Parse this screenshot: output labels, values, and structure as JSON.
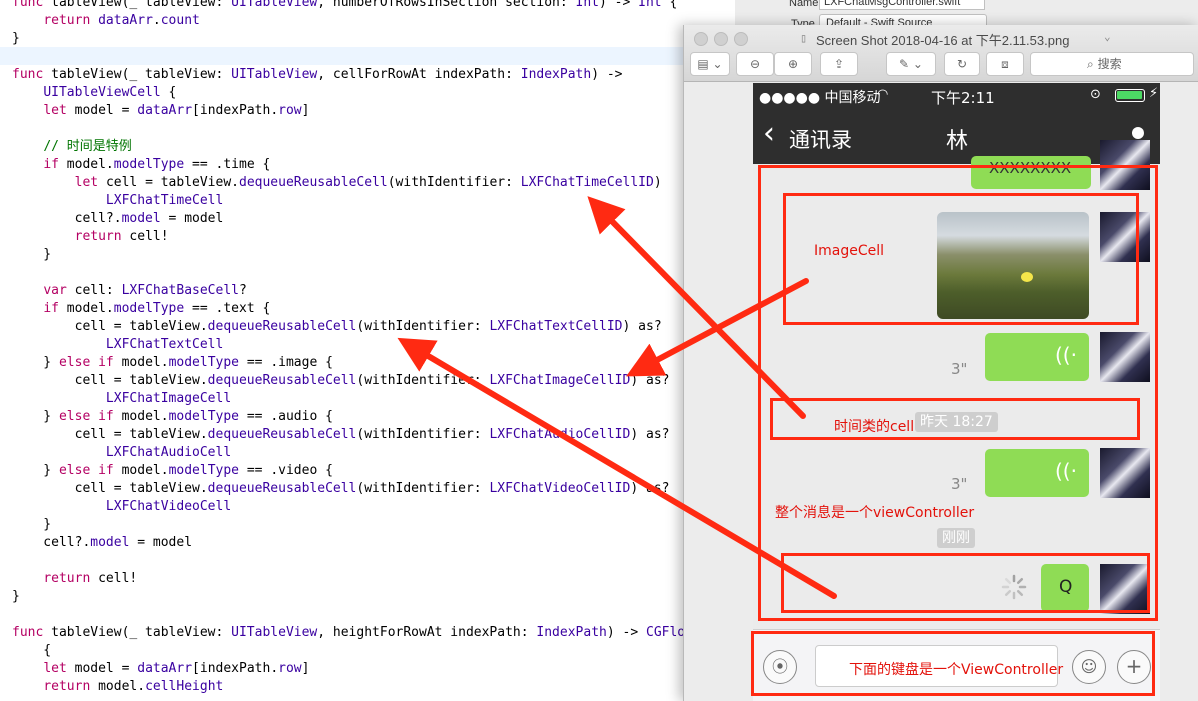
{
  "code": {
    "lines": [
      {
        "segs": [
          [
            "k",
            "func "
          ],
          [
            "",
            "tableView(_ tableView: "
          ],
          [
            "t",
            "UITableView"
          ],
          [
            "",
            ", numberOfRowsInSection section: "
          ],
          [
            "t",
            "Int"
          ],
          [
            "",
            ") -> "
          ],
          [
            "t",
            "Int"
          ],
          [
            "",
            " {"
          ]
        ]
      },
      {
        "segs": [
          [
            "",
            "    "
          ],
          [
            "k",
            "return "
          ],
          [
            "t",
            "dataArr"
          ],
          [
            "",
            "."
          ],
          [
            "t",
            "count"
          ]
        ]
      },
      {
        "segs": [
          [
            "",
            "}"
          ]
        ]
      },
      {
        "segs": [
          [
            "",
            ""
          ]
        ]
      },
      {
        "segs": [
          [
            "k",
            "func "
          ],
          [
            "",
            "tableView(_ tableView: "
          ],
          [
            "t",
            "UITableView"
          ],
          [
            "",
            ", cellForRowAt indexPath: "
          ],
          [
            "t",
            "IndexPath"
          ],
          [
            "",
            ") ->"
          ]
        ]
      },
      {
        "segs": [
          [
            "",
            "    "
          ],
          [
            "t",
            "UITableViewCell"
          ],
          [
            "",
            " {"
          ]
        ]
      },
      {
        "segs": [
          [
            "",
            "    "
          ],
          [
            "k",
            "let "
          ],
          [
            "",
            "model = "
          ],
          [
            "t",
            "dataArr"
          ],
          [
            "",
            "[indexPath."
          ],
          [
            "t",
            "row"
          ],
          [
            "",
            "]"
          ]
        ]
      },
      {
        "segs": [
          [
            "",
            ""
          ]
        ]
      },
      {
        "segs": [
          [
            "",
            "    "
          ],
          [
            "c",
            "// 时间是特例"
          ]
        ]
      },
      {
        "segs": [
          [
            "",
            "    "
          ],
          [
            "k",
            "if "
          ],
          [
            "",
            "model."
          ],
          [
            "t",
            "modelType"
          ],
          [
            "",
            " == .time {"
          ]
        ]
      },
      {
        "segs": [
          [
            "",
            "        "
          ],
          [
            "k",
            "let "
          ],
          [
            "",
            "cell = tableView."
          ],
          [
            "t",
            "dequeueReusableCell"
          ],
          [
            "",
            "(withIdentifier: "
          ],
          [
            "t",
            "LXFChatTimeCellID"
          ],
          [
            "",
            ")"
          ]
        ]
      },
      {
        "segs": [
          [
            "",
            "            "
          ],
          [
            "t",
            "LXFChatTimeCell"
          ]
        ]
      },
      {
        "segs": [
          [
            "",
            "        cell?."
          ],
          [
            "t",
            "model"
          ],
          [
            "",
            " = model"
          ]
        ]
      },
      {
        "segs": [
          [
            "",
            "        "
          ],
          [
            "k",
            "return "
          ],
          [
            "",
            "cell!"
          ]
        ]
      },
      {
        "segs": [
          [
            "",
            "    }"
          ]
        ]
      },
      {
        "segs": [
          [
            "",
            ""
          ]
        ]
      },
      {
        "segs": [
          [
            "",
            "    "
          ],
          [
            "k",
            "var "
          ],
          [
            "",
            "cell: "
          ],
          [
            "t",
            "LXFChatBaseCell"
          ],
          [
            "",
            "?"
          ]
        ]
      },
      {
        "segs": [
          [
            "",
            "    "
          ],
          [
            "k",
            "if "
          ],
          [
            "",
            "model."
          ],
          [
            "t",
            "modelType"
          ],
          [
            "",
            " == .text {"
          ]
        ]
      },
      {
        "segs": [
          [
            "",
            "        cell = tableView."
          ],
          [
            "t",
            "dequeueReusableCell"
          ],
          [
            "",
            "(withIdentifier: "
          ],
          [
            "t",
            "LXFChatTextCellID"
          ],
          [
            "",
            ") as?"
          ]
        ]
      },
      {
        "segs": [
          [
            "",
            "            "
          ],
          [
            "t",
            "LXFChatTextCell"
          ]
        ]
      },
      {
        "segs": [
          [
            "",
            "    } "
          ],
          [
            "k",
            "else if "
          ],
          [
            "",
            "model."
          ],
          [
            "t",
            "modelType"
          ],
          [
            "",
            " == .image {"
          ]
        ]
      },
      {
        "segs": [
          [
            "",
            "        cell = tableView."
          ],
          [
            "t",
            "dequeueReusableCell"
          ],
          [
            "",
            "(withIdentifier: "
          ],
          [
            "t",
            "LXFChatImageCellID"
          ],
          [
            "",
            ") as?"
          ]
        ]
      },
      {
        "segs": [
          [
            "",
            "            "
          ],
          [
            "t",
            "LXFChatImageCell"
          ]
        ]
      },
      {
        "segs": [
          [
            "",
            "    } "
          ],
          [
            "k",
            "else if "
          ],
          [
            "",
            "model."
          ],
          [
            "t",
            "modelType"
          ],
          [
            "",
            " == .audio {"
          ]
        ]
      },
      {
        "segs": [
          [
            "",
            "        cell = tableView."
          ],
          [
            "t",
            "dequeueReusableCell"
          ],
          [
            "",
            "(withIdentifier: "
          ],
          [
            "t",
            "LXFChatAudioCellID"
          ],
          [
            "",
            ") as?"
          ]
        ]
      },
      {
        "segs": [
          [
            "",
            "            "
          ],
          [
            "t",
            "LXFChatAudioCell"
          ]
        ]
      },
      {
        "segs": [
          [
            "",
            "    } "
          ],
          [
            "k",
            "else if "
          ],
          [
            "",
            "model."
          ],
          [
            "t",
            "modelType"
          ],
          [
            "",
            " == .video {"
          ]
        ]
      },
      {
        "segs": [
          [
            "",
            "        cell = tableView."
          ],
          [
            "t",
            "dequeueReusableCell"
          ],
          [
            "",
            "(withIdentifier: "
          ],
          [
            "t",
            "LXFChatVideoCellID"
          ],
          [
            "",
            ") as?"
          ]
        ]
      },
      {
        "segs": [
          [
            "",
            "            "
          ],
          [
            "t",
            "LXFChatVideoCell"
          ]
        ]
      },
      {
        "segs": [
          [
            "",
            "    }"
          ]
        ]
      },
      {
        "segs": [
          [
            "",
            "    cell?."
          ],
          [
            "t",
            "model"
          ],
          [
            "",
            " = model"
          ]
        ]
      },
      {
        "segs": [
          [
            "",
            ""
          ]
        ]
      },
      {
        "segs": [
          [
            "",
            "    "
          ],
          [
            "k",
            "return "
          ],
          [
            "",
            "cell!"
          ]
        ]
      },
      {
        "segs": [
          [
            "",
            "}"
          ]
        ]
      },
      {
        "segs": [
          [
            "",
            ""
          ]
        ]
      },
      {
        "segs": [
          [
            "k",
            "func "
          ],
          [
            "",
            "tableView(_ tableView: "
          ],
          [
            "t",
            "UITableView"
          ],
          [
            "",
            ", heightForRowAt indexPath: "
          ],
          [
            "t",
            "IndexPath"
          ],
          [
            "",
            ") -> "
          ],
          [
            "t",
            "CGFloat"
          ]
        ]
      },
      {
        "segs": [
          [
            "",
            "    {"
          ]
        ]
      },
      {
        "segs": [
          [
            "",
            "    "
          ],
          [
            "k",
            "let "
          ],
          [
            "",
            "model = "
          ],
          [
            "t",
            "dataArr"
          ],
          [
            "",
            "[indexPath."
          ],
          [
            "t",
            "row"
          ],
          [
            "",
            "]"
          ]
        ]
      },
      {
        "segs": [
          [
            "",
            "    "
          ],
          [
            "k",
            "return "
          ],
          [
            "",
            "model."
          ],
          [
            "t",
            "cellHeight"
          ]
        ]
      }
    ]
  },
  "inspector": {
    "name_label": "Name",
    "name_value": "LXFChatMsgController.swift",
    "type_label": "Type",
    "type_value": "Default - Swift Source"
  },
  "window": {
    "title": "Screen Shot 2018-04-16 at 下午2.11.53.png",
    "search_placeholder": "搜索"
  },
  "phone": {
    "carrier": "●●●●● 中国移动",
    "time": "下午2:11",
    "back_label": "通讯录",
    "nav_title": "林",
    "text_bubble": "XXXXXXXX",
    "audio_duration_1": "3\"",
    "audio_duration_2": "3\"",
    "time_pill_1": "昨天 18:27",
    "time_pill_2": "刚刚",
    "sent_text": "Q"
  },
  "annotations": {
    "image_cell": "ImageCell",
    "time_cell": "时间类的cell",
    "view_controller": "整个消息是一个viewController",
    "keyboard": "下面的键盘是一个ViewController"
  },
  "colors": {
    "annotation_red": "#ff2a12",
    "bubble_green": "#8fdc55",
    "nav_dark": "#2e2e2e"
  }
}
